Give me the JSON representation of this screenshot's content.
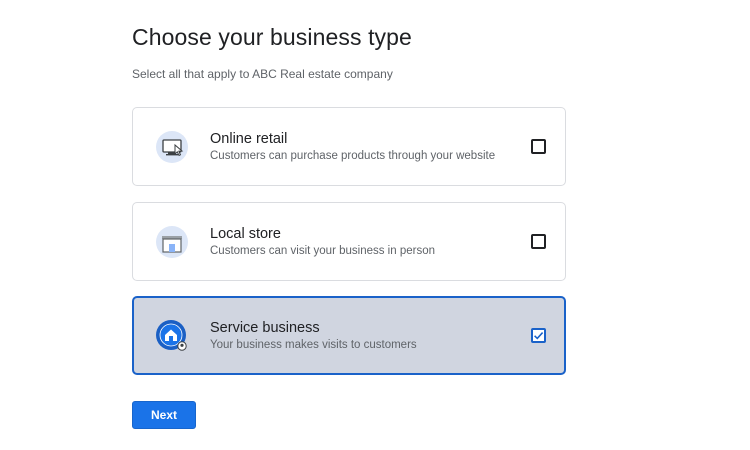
{
  "page": {
    "title": "Choose your business type",
    "subtitle": "Select all that apply to ABC Real estate company"
  },
  "options": [
    {
      "title": "Online retail",
      "description": "Customers can purchase products through your website",
      "icon": "computer-cursor-icon",
      "checked": false
    },
    {
      "title": "Local store",
      "description": "Customers can visit your business in person",
      "icon": "storefront-icon",
      "checked": false
    },
    {
      "title": "Service business",
      "description": "Your business makes visits to customers",
      "icon": "house-location-icon",
      "checked": true
    }
  ],
  "actions": {
    "next_label": "Next"
  },
  "colors": {
    "accent": "#1a73e8",
    "selected_bg": "#d0d5e0",
    "selected_border": "#1a62c9",
    "icon_bg": "#dce6f7"
  }
}
